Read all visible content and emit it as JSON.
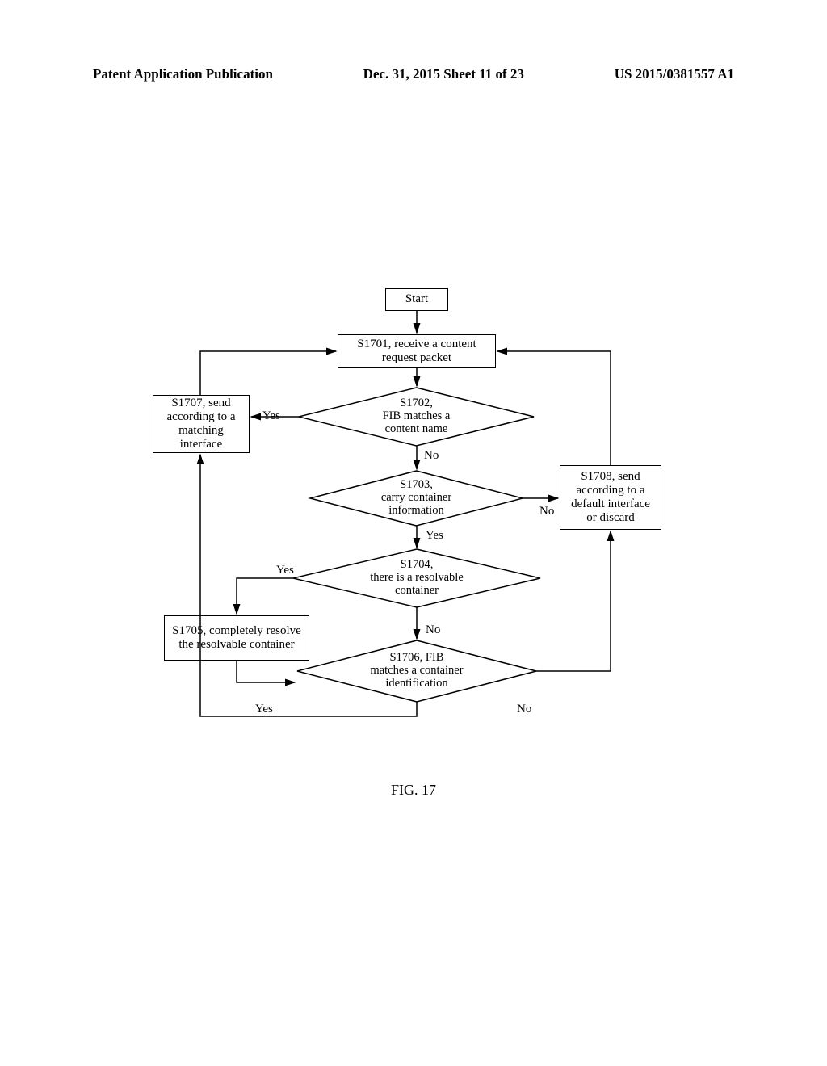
{
  "header": {
    "left": "Patent Application Publication",
    "center": "Dec. 31, 2015   Sheet 11 of 23",
    "right": "US 2015/0381557 A1"
  },
  "nodes": {
    "start": "Start",
    "s1701": "S1701, receive a content request packet",
    "s1702": "S1702,\nFIB matches a\ncontent name",
    "s1703": "S1703,\ncarry container\ninformation",
    "s1704": "S1704,\nthere is a resolvable\ncontainer",
    "s1705": "S1705, completely resolve the resolvable container",
    "s1706": "S1706, FIB\nmatches a container\nidentification",
    "s1707": "S1707, send according to a matching interface",
    "s1708": "S1708, send according to a default interface or discard"
  },
  "labels": {
    "yes": "Yes",
    "no": "No"
  },
  "figure_caption": "FIG. 17",
  "chart_data": {
    "type": "table",
    "description": "Flowchart of content request packet processing",
    "nodes": [
      {
        "id": "start",
        "type": "terminator",
        "text": "Start"
      },
      {
        "id": "S1701",
        "type": "process",
        "text": "S1701, receive a content request packet"
      },
      {
        "id": "S1702",
        "type": "decision",
        "text": "S1702, FIB matches a content name"
      },
      {
        "id": "S1703",
        "type": "decision",
        "text": "S1703, carry container information"
      },
      {
        "id": "S1704",
        "type": "decision",
        "text": "S1704, there is a resolvable container"
      },
      {
        "id": "S1705",
        "type": "process",
        "text": "S1705, completely resolve the resolvable container"
      },
      {
        "id": "S1706",
        "type": "decision",
        "text": "S1706, FIB matches a container identification"
      },
      {
        "id": "S1707",
        "type": "process",
        "text": "S1707, send according to a matching interface"
      },
      {
        "id": "S1708",
        "type": "process",
        "text": "S1708, send according to a default interface or discard"
      }
    ],
    "edges": [
      {
        "from": "start",
        "to": "S1701"
      },
      {
        "from": "S1701",
        "to": "S1702"
      },
      {
        "from": "S1702",
        "to": "S1707",
        "label": "Yes"
      },
      {
        "from": "S1702",
        "to": "S1703",
        "label": "No"
      },
      {
        "from": "S1703",
        "to": "S1708",
        "label": "No"
      },
      {
        "from": "S1703",
        "to": "S1704",
        "label": "Yes"
      },
      {
        "from": "S1704",
        "to": "S1705",
        "label": "Yes"
      },
      {
        "from": "S1704",
        "to": "S1706",
        "label": "No"
      },
      {
        "from": "S1705",
        "to": "S1706"
      },
      {
        "from": "S1706",
        "to": "S1707",
        "label": "Yes"
      },
      {
        "from": "S1706",
        "to": "S1708",
        "label": "No"
      },
      {
        "from": "S1707",
        "to": "S1701"
      },
      {
        "from": "S1708",
        "to": "S1701"
      }
    ]
  }
}
